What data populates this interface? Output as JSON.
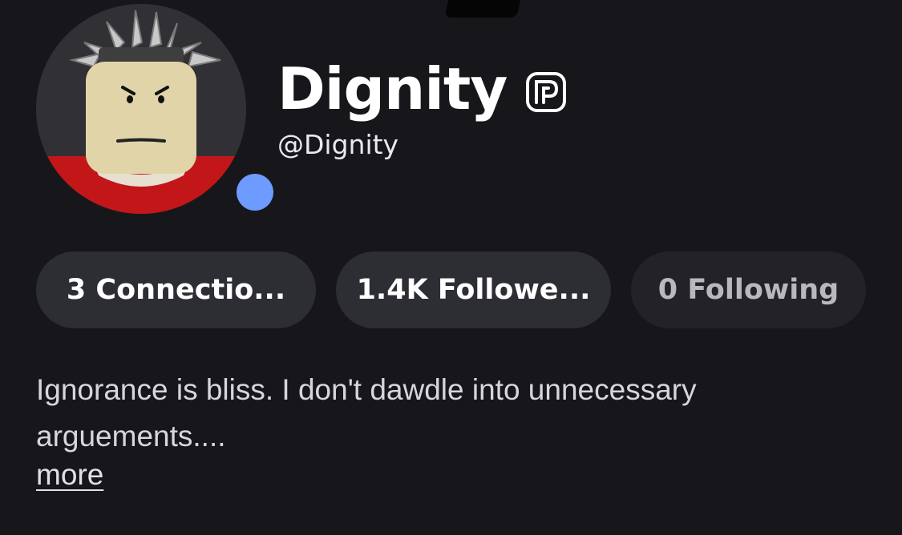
{
  "profile": {
    "display_name": "Dignity",
    "username": "@Dignity",
    "verified_icon": "verified-badge-icon",
    "presence_color": "#6d9bff"
  },
  "stats": {
    "connections": "3 Connectio...",
    "followers": "1.4K Followe...",
    "following": "0 Following"
  },
  "bio": {
    "text": "Ignorance is bliss. I don't dawdle into unnecessary arguements....",
    "more_label": "more"
  },
  "colors": {
    "background": "#17171b",
    "chip": "#2d2d34",
    "accent_blue": "#6d9bff"
  }
}
